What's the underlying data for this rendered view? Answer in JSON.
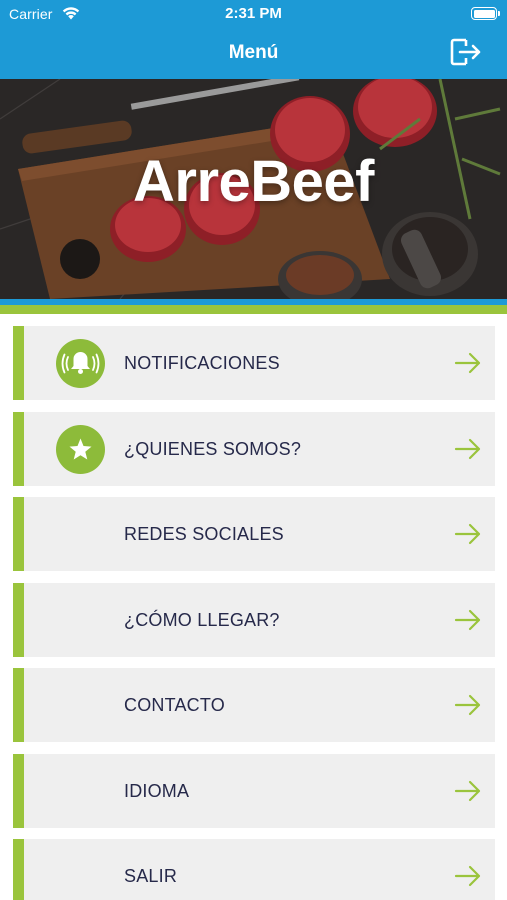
{
  "status_bar": {
    "carrier": "Carrier",
    "time": "2:31 PM"
  },
  "nav": {
    "title": "Menú",
    "logout_icon": "logout-icon"
  },
  "hero": {
    "brand": "ArreBeef"
  },
  "colors": {
    "primary_blue": "#1d9ad6",
    "accent_green": "#9ac43c",
    "text_navy": "#26294a",
    "item_bg": "#efefef"
  },
  "menu": [
    {
      "label": "NOTIFICACIONES",
      "icon": "bell-icon"
    },
    {
      "label": "¿QUIENES SOMOS?",
      "icon": "star-icon"
    },
    {
      "label": "REDES SOCIALES",
      "icon": ""
    },
    {
      "label": "¿CÓMO LLEGAR?",
      "icon": ""
    },
    {
      "label": "CONTACTO",
      "icon": ""
    },
    {
      "label": "IDIOMA",
      "icon": ""
    },
    {
      "label": "SALIR",
      "icon": ""
    }
  ]
}
